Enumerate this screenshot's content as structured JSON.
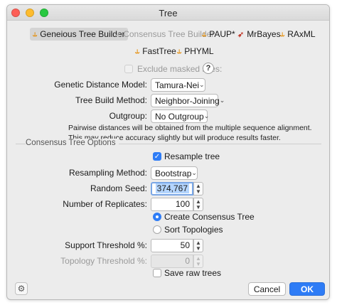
{
  "window": {
    "title": "Tree"
  },
  "tabs": [
    {
      "label": "Geneious Tree Builder",
      "icon": "tree-icon",
      "state": "active"
    },
    {
      "label": "Consensus Tree Builder",
      "icon": "tree-icon",
      "state": "disabled"
    },
    {
      "label": "PAUP*",
      "icon": "tree-icon",
      "state": "normal"
    },
    {
      "label": "MrBayes",
      "icon": "mrbayes-icon",
      "state": "normal"
    },
    {
      "label": "RAxML",
      "icon": "tree-icon",
      "state": "normal"
    },
    {
      "label": "FastTree",
      "icon": "tree-icon",
      "state": "normal"
    },
    {
      "label": "PHYML",
      "icon": "tree-icon",
      "state": "normal"
    }
  ],
  "exclude_masked": {
    "label": "Exclude masked sites:",
    "checked": false,
    "enabled": false,
    "help": "?"
  },
  "genetic_distance": {
    "label": "Genetic Distance Model:",
    "value": "Tamura-Nei"
  },
  "tree_build": {
    "label": "Tree Build Method:",
    "value": "Neighbor-Joining"
  },
  "outgroup": {
    "label": "Outgroup:",
    "value": "No Outgroup"
  },
  "info_text": {
    "line1": "Pairwise distances will be obtained from the multiple sequence alignment.",
    "line2": "This may reduce accuracy slightly but will produce results faster."
  },
  "consensus": {
    "section_title": "Consensus Tree Options",
    "resample": {
      "label": "Resample tree",
      "checked": true
    },
    "resampling_method": {
      "label": "Resampling Method:",
      "value": "Bootstrap"
    },
    "random_seed": {
      "label": "Random Seed:",
      "value": "374,767"
    },
    "replicates": {
      "label": "Number of Replicates:",
      "value": "100"
    },
    "create_consensus": {
      "label": "Create Consensus Tree",
      "selected": true
    },
    "sort_topologies": {
      "label": "Sort Topologies",
      "selected": false
    },
    "support_threshold": {
      "label": "Support Threshold %:",
      "value": "50"
    },
    "topology_threshold": {
      "label": "Topology Threshold %:",
      "value": "0",
      "enabled": false
    },
    "save_raw": {
      "label": "Save raw trees",
      "checked": false
    }
  },
  "footer": {
    "cancel": "Cancel",
    "ok": "OK"
  },
  "colors": {
    "accent": "#2e7cf6",
    "tab_icon": "#e58a00",
    "mrbayes_icon": "#c0392b"
  }
}
